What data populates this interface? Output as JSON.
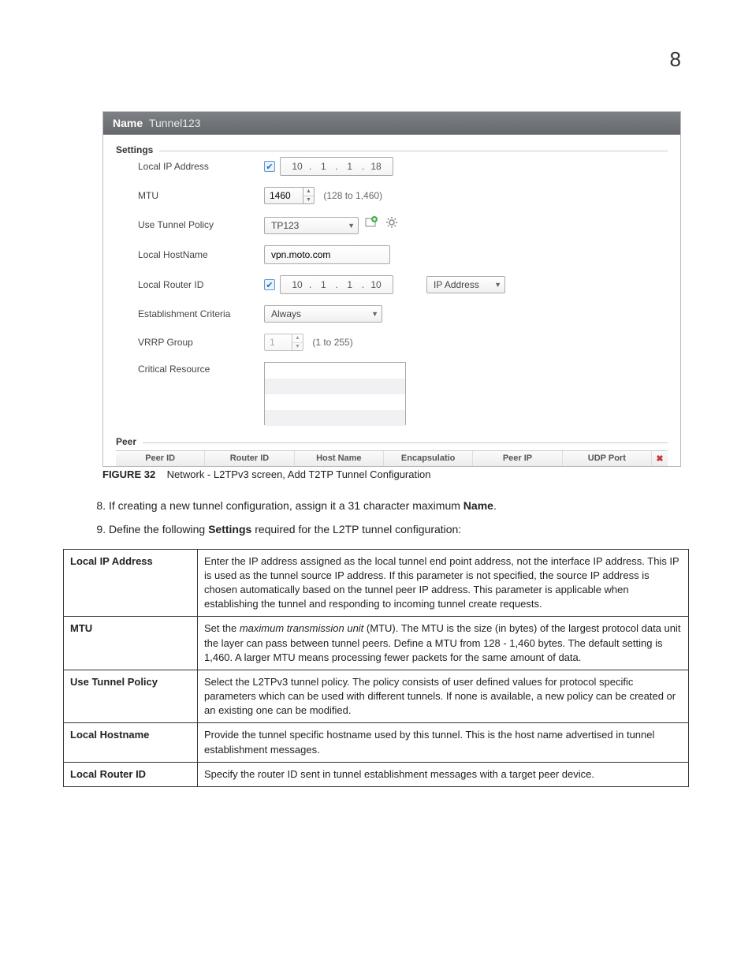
{
  "page_number": "8",
  "screenshot": {
    "title_label": "Name",
    "title_value": "Tunnel123",
    "settings_legend": "Settings",
    "peer_legend": "Peer",
    "labels": {
      "local_ip": "Local IP Address",
      "mtu": "MTU",
      "use_tunnel_policy": "Use Tunnel Policy",
      "local_hostname": "Local HostName",
      "local_router_id": "Local Router ID",
      "establishment": "Establishment Criteria",
      "vrrp": "VRRP Group",
      "critical": "Critical Resource"
    },
    "values": {
      "local_ip": [
        "10",
        "1",
        "1",
        "18"
      ],
      "mtu": "1460",
      "mtu_hint": "(128 to 1,460)",
      "policy": "TP123",
      "hostname": "vpn.moto.com",
      "router_ip": [
        "10",
        "1",
        "1",
        "10"
      ],
      "router_id_type": "IP Address",
      "establishment": "Always",
      "vrrp": "1",
      "vrrp_hint": "(1 to 255)"
    },
    "peer_headers": [
      "Peer ID",
      "Router ID",
      "Host Name",
      "Encapsulatio",
      "Peer IP",
      "UDP Port"
    ]
  },
  "figure": {
    "label": "FIGURE 32",
    "caption": "Network - L2TPv3 screen, Add T2TP Tunnel Configuration"
  },
  "steps": {
    "s8_a": "If creating a new tunnel configuration, assign it a 31 character maximum ",
    "s8_b": "Name",
    "s8_c": ".",
    "s9_a": "Define the following ",
    "s9_b": "Settings",
    "s9_c": " required for the L2TP tunnel configuration:"
  },
  "table": {
    "rows": [
      {
        "term": "Local IP Address",
        "desc": "Enter the IP address assigned as the local tunnel end point address, not the interface IP address. This IP is used as the tunnel source IP address. If this parameter is not specified, the source IP address is chosen automatically based on the tunnel peer IP address. This parameter is applicable when establishing the tunnel and responding to incoming tunnel create requests."
      },
      {
        "term": "MTU",
        "desc_pre": "Set the ",
        "desc_em": "maximum transmission unit",
        "desc_post": " (MTU). The MTU is the size (in bytes) of the largest protocol data unit the layer can pass between tunnel peers. Define a MTU from 128 - 1,460 bytes. The default setting is 1,460. A larger MTU means processing fewer packets for the same amount of data."
      },
      {
        "term": "Use Tunnel Policy",
        "desc": "Select the L2TPv3 tunnel policy. The policy consists of user defined values for protocol specific parameters which can be used with different tunnels. If none is available, a new policy can be created or an existing one can be modified."
      },
      {
        "term": "Local Hostname",
        "desc": "Provide the tunnel specific hostname used by this tunnel. This is the host name advertised in tunnel establishment messages."
      },
      {
        "term": "Local Router ID",
        "desc": "Specify the router ID sent in tunnel establishment messages with a target peer device."
      }
    ]
  }
}
